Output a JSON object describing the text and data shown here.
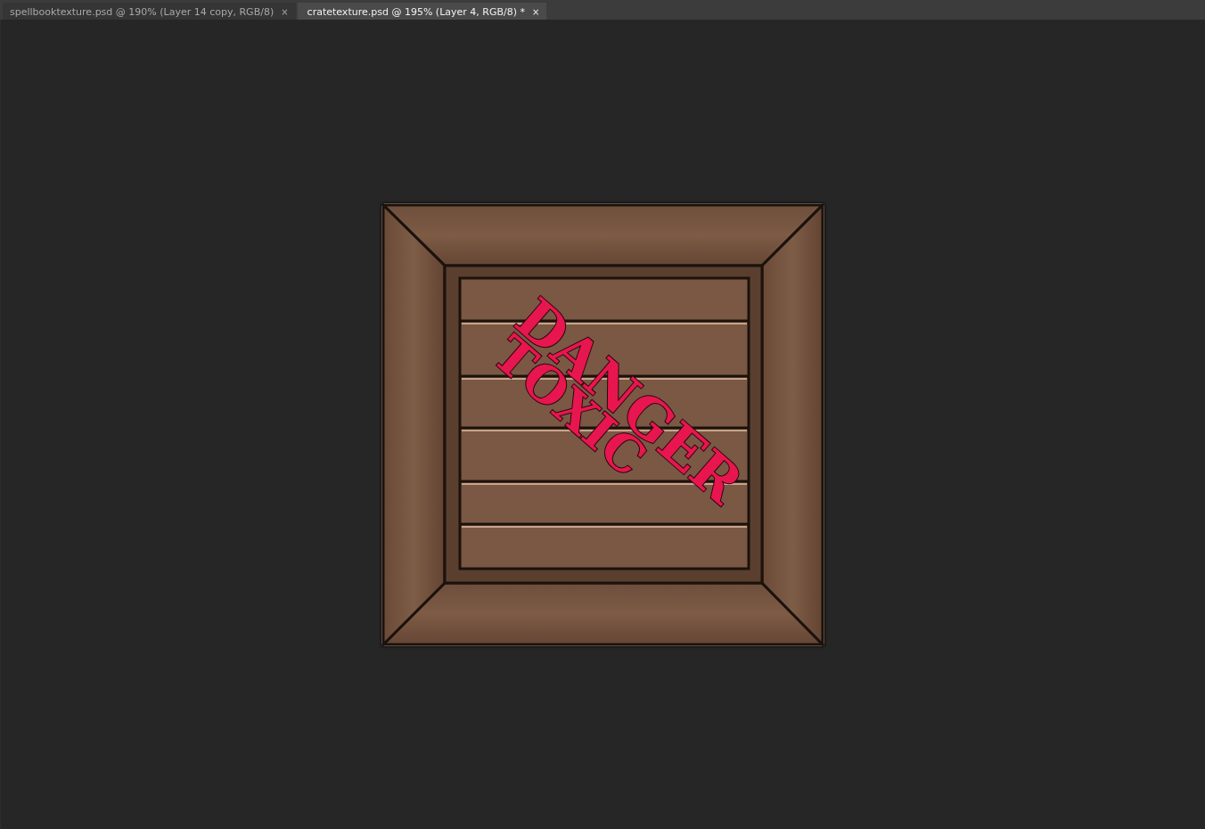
{
  "tabs": [
    {
      "label": "spellbooktexture.psd @ 190% (Layer 14 copy, RGB/8)",
      "close": "×",
      "selected": false
    },
    {
      "label": "cratetexture.psd @ 195% (Layer 4, RGB/8) *",
      "close": "×",
      "selected": true
    }
  ],
  "canvas": {
    "stencil_lines": [
      "DANGER",
      "TOXIC"
    ]
  }
}
